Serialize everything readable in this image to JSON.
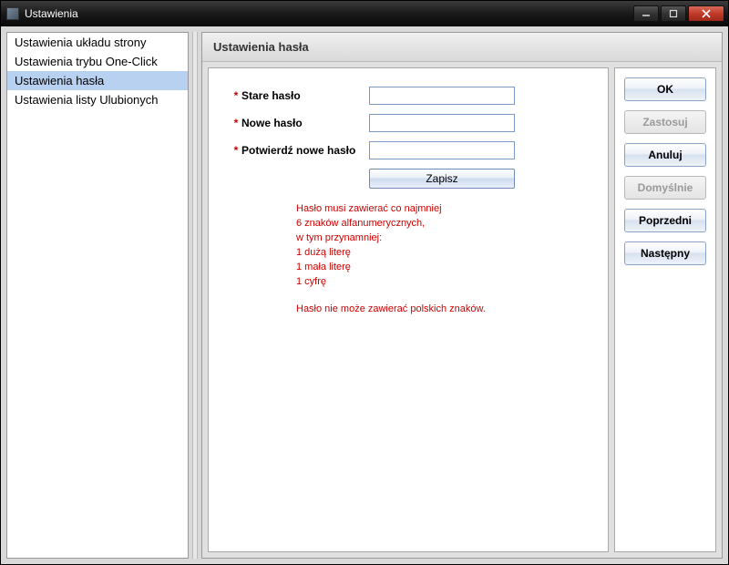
{
  "window": {
    "title": "Ustawienia"
  },
  "sidebar": {
    "items": [
      {
        "label": "Ustawienia układu strony",
        "selected": false
      },
      {
        "label": "Ustawienia trybu One-Click",
        "selected": false
      },
      {
        "label": "Ustawienia hasła",
        "selected": true
      },
      {
        "label": "Ustawienia listy Ulubionych",
        "selected": false
      }
    ]
  },
  "panel": {
    "title": "Ustawienia hasła",
    "fields": {
      "old_pw_label": "Stare hasło",
      "new_pw_label": "Nowe hasło",
      "confirm_pw_label": "Potwierdź nowe hasło",
      "required_mark": "*"
    },
    "save_label": "Zapisz",
    "rules": {
      "line1": "Hasło musi zawierać co najmniej",
      "line2": "6 znaków alfanumerycznych,",
      "line3": "w tym przynamniej:",
      "line4": "1 dużą literę",
      "line5": "1 mała literę",
      "line6": "1 cyfrę",
      "line7": "Hasło nie może zawierać polskich znaków."
    }
  },
  "buttons": {
    "ok": "OK",
    "apply": "Zastosuj",
    "cancel": "Anuluj",
    "default": "Domyślnie",
    "prev": "Poprzedni",
    "next": "Następny"
  }
}
